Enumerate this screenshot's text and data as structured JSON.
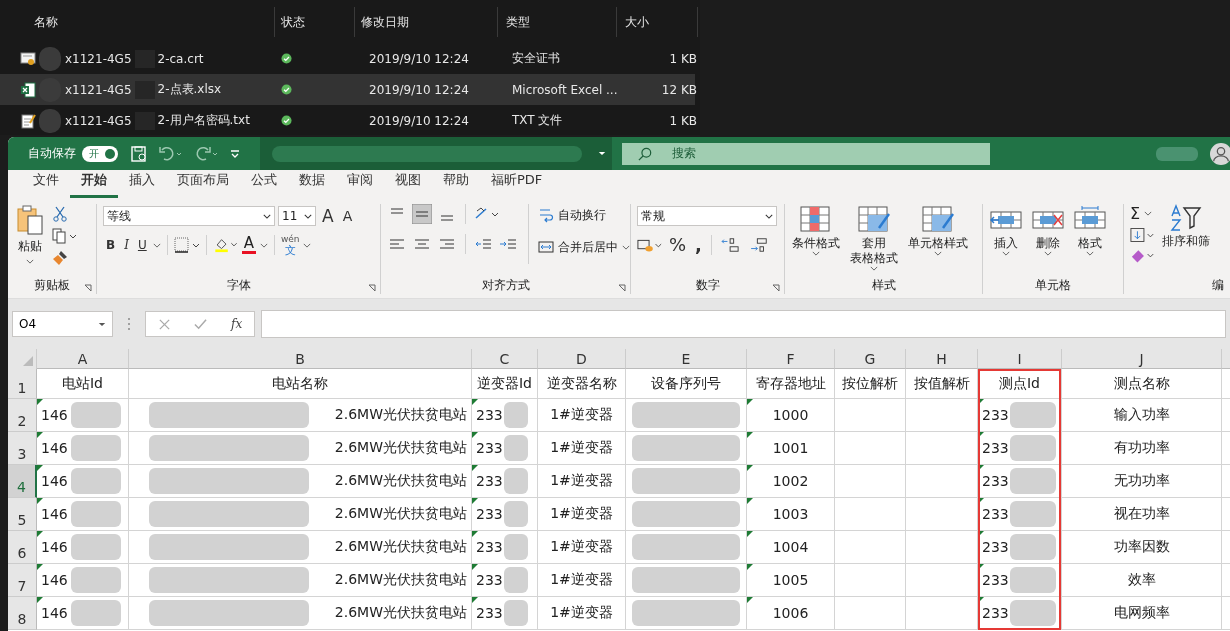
{
  "explorer": {
    "columns": [
      "名称",
      "状态",
      "修改日期",
      "类型",
      "大小"
    ],
    "files": [
      {
        "kind": "cert",
        "name_start": "x1121-4G5",
        "name_end": "2-ca.crt",
        "date": "2019/9/10 12:24",
        "type": "安全证书",
        "size": "1 KB",
        "selected": false
      },
      {
        "kind": "excel",
        "name_start": "x1121-4G5",
        "name_end": "2-点表.xlsx",
        "date": "2019/9/10 12:24",
        "type": "Microsoft Excel ...",
        "size": "12 KB",
        "selected": true
      },
      {
        "kind": "text",
        "name_start": "x1121-4G5",
        "name_end": "2-用户名密码.txt",
        "date": "2019/9/10 12:24",
        "type": "TXT 文件",
        "size": "1 KB",
        "selected": false
      }
    ]
  },
  "excel": {
    "autosave": {
      "label": "自动保存",
      "toggle": "开",
      "on": true
    },
    "search": {
      "placeholder": "搜索"
    },
    "tabs": [
      {
        "label": "文件",
        "selected": false
      },
      {
        "label": "开始",
        "selected": true
      },
      {
        "label": "插入",
        "selected": false
      },
      {
        "label": "页面布局",
        "selected": false
      },
      {
        "label": "公式",
        "selected": false
      },
      {
        "label": "数据",
        "selected": false
      },
      {
        "label": "审阅",
        "selected": false
      },
      {
        "label": "视图",
        "selected": false
      },
      {
        "label": "帮助",
        "selected": false
      },
      {
        "label": "福昕PDF",
        "selected": false
      }
    ],
    "ribbon": {
      "clipboard": {
        "paste": "粘贴",
        "label": "剪贴板"
      },
      "font": {
        "name": "等线",
        "size": "11",
        "bold": "B",
        "italic": "I",
        "underline": "U",
        "phonetic_top": "wén",
        "phonetic_bottom": "文",
        "grow": "A",
        "shrink": "A",
        "color_letter": "A",
        "label": "字体"
      },
      "alignment": {
        "wrap": "自动换行",
        "merge": "合并后居中",
        "label": "对齐方式"
      },
      "number": {
        "format": "常规",
        "percent": "%",
        "comma": ",",
        "label": "数字"
      },
      "styles": {
        "buttons": [
          [
            "条件格式"
          ],
          [
            "套用",
            "表格格式"
          ],
          [
            "单元格样式"
          ]
        ],
        "label": "样式"
      },
      "cells": {
        "buttons": [
          "插入",
          "删除",
          "格式"
        ],
        "label": "单元格"
      },
      "editing": {
        "sort": "排序和筛",
        "sigma": "Σ",
        "label": "编"
      }
    },
    "formula_bar": {
      "name_box": "O4",
      "fx": "fx"
    },
    "sheet": {
      "columns": [
        {
          "letter": "A",
          "highlight": false,
          "flag": true,
          "redacted": true
        },
        {
          "letter": "B",
          "highlight": false,
          "flag": false,
          "redacted": true
        },
        {
          "letter": "C",
          "highlight": false,
          "flag": true,
          "redacted": true
        },
        {
          "letter": "D",
          "highlight": false,
          "flag": false,
          "redacted": false
        },
        {
          "letter": "E",
          "highlight": false,
          "flag": false,
          "redacted": true
        },
        {
          "letter": "F",
          "highlight": false,
          "flag": true,
          "redacted": false
        },
        {
          "letter": "G",
          "highlight": false,
          "flag": false,
          "redacted": false
        },
        {
          "letter": "H",
          "highlight": false,
          "flag": false,
          "redacted": false
        },
        {
          "letter": "I",
          "highlight": true,
          "flag": true,
          "redacted": true
        },
        {
          "letter": "J",
          "highlight": false,
          "flag": false,
          "redacted": false
        }
      ],
      "header": {
        "num": "1",
        "cells": [
          "电站Id",
          "电站名称",
          "逆变器Id",
          "逆变器名称",
          "设备序列号",
          "寄存器地址",
          "按位解析",
          "按值解析",
          "测点Id",
          "测点名称"
        ]
      },
      "rows": [
        {
          "num": "2",
          "selected": false,
          "cells": [
            "146",
            "2.6MW光伏扶贫电站",
            "233",
            "1#逆变器",
            null,
            "1000",
            null,
            null,
            "233",
            "输入功率"
          ]
        },
        {
          "num": "3",
          "selected": false,
          "cells": [
            "146",
            "2.6MW光伏扶贫电站",
            "233",
            "1#逆变器",
            null,
            "1001",
            null,
            null,
            "233",
            "有功功率"
          ]
        },
        {
          "num": "4",
          "selected": true,
          "cells": [
            "146",
            "2.6MW光伏扶贫电站",
            "233",
            "1#逆变器",
            null,
            "1002",
            null,
            null,
            "233",
            "无功功率"
          ]
        },
        {
          "num": "5",
          "selected": false,
          "cells": [
            "146",
            "2.6MW光伏扶贫电站",
            "233",
            "1#逆变器",
            null,
            "1003",
            null,
            null,
            "233",
            "视在功率"
          ]
        },
        {
          "num": "6",
          "selected": false,
          "cells": [
            "146",
            "2.6MW光伏扶贫电站",
            "233",
            "1#逆变器",
            null,
            "1004",
            null,
            null,
            "233",
            "功率因数"
          ]
        },
        {
          "num": "7",
          "selected": false,
          "cells": [
            "146",
            "2.6MW光伏扶贫电站",
            "233",
            "1#逆变器",
            null,
            "1005",
            null,
            null,
            "233",
            "效率"
          ]
        },
        {
          "num": "8",
          "selected": false,
          "cells": [
            "146",
            "2.6MW光伏扶贫电站",
            "233",
            "1#逆变器",
            null,
            "1006",
            null,
            null,
            "233",
            "电网频率"
          ]
        }
      ]
    }
  }
}
